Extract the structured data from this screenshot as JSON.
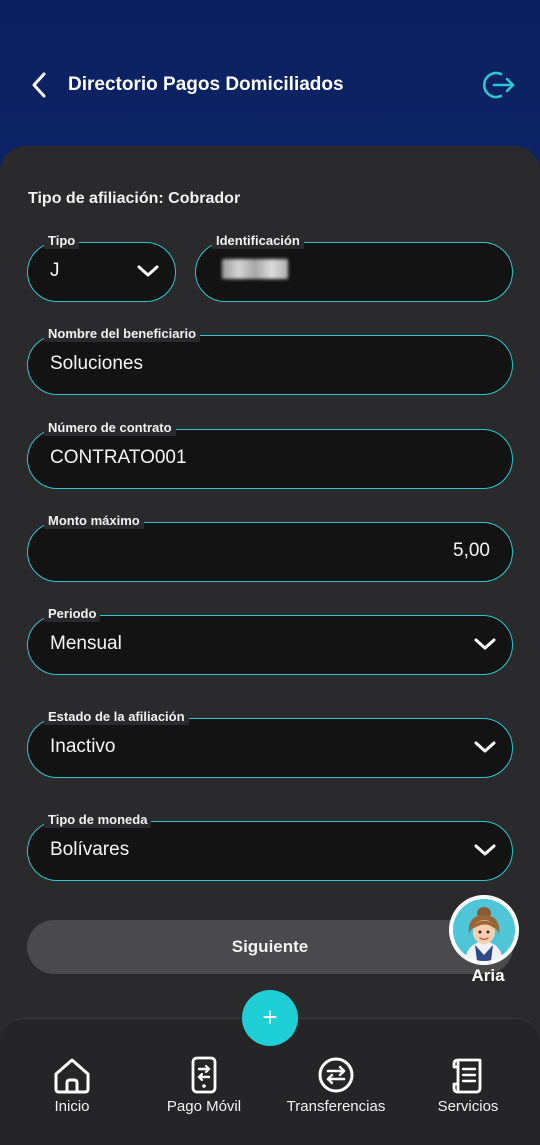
{
  "header": {
    "title": "Directorio Pagos Domiciliados"
  },
  "form": {
    "section_title": "Tipo de afiliación: Cobrador",
    "tipo": {
      "label": "Tipo",
      "value": "J"
    },
    "identificacion": {
      "label": "Identificación"
    },
    "beneficiario": {
      "label": "Nombre del beneficiario",
      "value": "Soluciones"
    },
    "contrato": {
      "label": "Número de contrato",
      "value": "CONTRATO001"
    },
    "monto": {
      "label": "Monto máximo",
      "value": "5,00"
    },
    "periodo": {
      "label": "Periodo",
      "value": "Mensual"
    },
    "estado": {
      "label": "Estado de la afiliación",
      "value": "Inactivo"
    },
    "moneda": {
      "label": "Tipo de moneda",
      "value": "Bolívares"
    },
    "next_label": "Siguiente"
  },
  "assistant": {
    "name": "Aria"
  },
  "fab": {
    "label": "+"
  },
  "nav": {
    "items": [
      {
        "label": "Inicio",
        "icon": "home-icon"
      },
      {
        "label": "Pago Móvil",
        "icon": "phone-transfer-icon"
      },
      {
        "label": "Transferencias",
        "icon": "transfer-icon"
      },
      {
        "label": "Servicios",
        "icon": "receipt-icon"
      }
    ]
  },
  "colors": {
    "accent": "#2bc6d0",
    "header_bg": "#0b2266",
    "card_bg": "#2a2a2c",
    "fab": "#1ecfd6"
  }
}
